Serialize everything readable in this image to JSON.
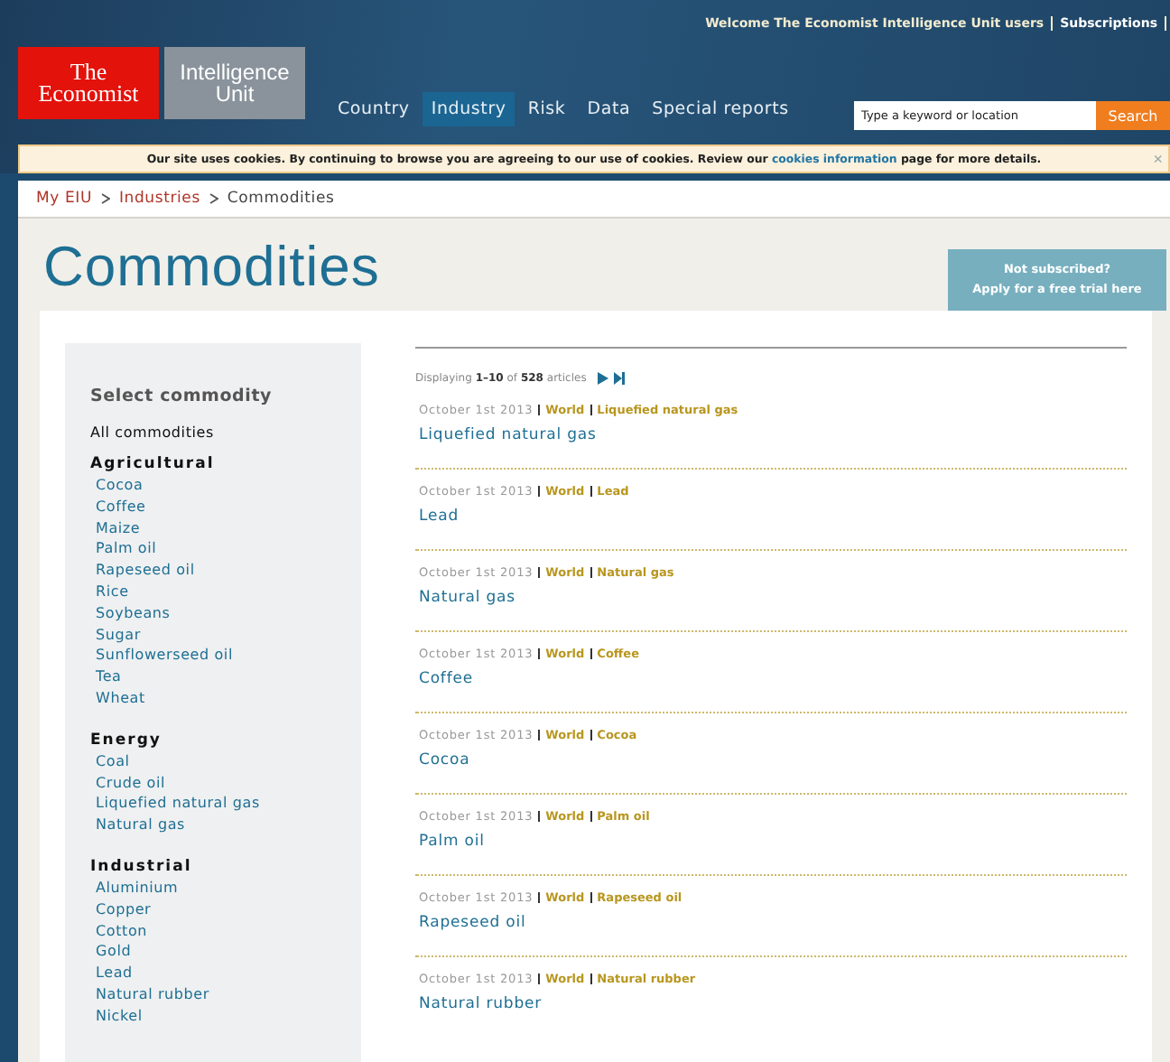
{
  "header": {
    "welcome": "Welcome The Economist Intelligence Unit users",
    "subscriptions": "Subscriptions",
    "logo_top": "The",
    "logo_bottom": "Economist",
    "unit_top": "Intelligence",
    "unit_bottom": "Unit",
    "nav": [
      {
        "label": "Country",
        "selected": false
      },
      {
        "label": "Industry",
        "selected": true
      },
      {
        "label": "Risk",
        "selected": false
      },
      {
        "label": "Data",
        "selected": false
      },
      {
        "label": "Special reports",
        "selected": false
      }
    ],
    "search": {
      "placeholder": "Type a keyword or location",
      "button": "Search"
    }
  },
  "cookie_notice": {
    "before": "Our site uses cookies. By continuing to browse you are agreeing to our use of cookies. Review our",
    "link": "cookies information",
    "after": "page for more details.",
    "close": "×"
  },
  "breadcrumb": [
    {
      "label": "My EIU",
      "current": false
    },
    {
      "label": "Industries",
      "current": false
    },
    {
      "label": "Commodities",
      "current": true
    }
  ],
  "title": "Commodities",
  "trial": {
    "line1": "Not subscribed?",
    "line2": "Apply for a free trial here"
  },
  "sidebar": {
    "heading": "Select commodity",
    "all": "All commodities",
    "groups": [
      {
        "name": "Agricultural",
        "items": [
          "Cocoa",
          "Coffee",
          "Maize",
          "Palm oil",
          "Rapeseed oil",
          "Rice",
          "Soybeans",
          "Sugar",
          "Sunflowerseed oil",
          "Tea",
          "Wheat"
        ]
      },
      {
        "name": "Energy",
        "items": [
          "Coal",
          "Crude oil",
          "Liquefied natural gas",
          "Natural gas"
        ]
      },
      {
        "name": "Industrial",
        "items": [
          "Aluminium",
          "Copper",
          "Cotton",
          "Gold",
          "Lead",
          "Natural rubber",
          "Nickel"
        ]
      }
    ]
  },
  "pager": {
    "text": "Displaying **1–10** of **528** articles"
  },
  "articles": [
    {
      "date": "October 1st 2013",
      "region": "World",
      "category": "Liquefied natural gas",
      "title": "Liquefied natural gas"
    },
    {
      "date": "October 1st 2013",
      "region": "World",
      "category": "Lead",
      "title": "Lead"
    },
    {
      "date": "October 1st 2013",
      "region": "World",
      "category": "Natural gas",
      "title": "Natural gas"
    },
    {
      "date": "October 1st 2013",
      "region": "World",
      "category": "Coffee",
      "title": "Coffee"
    },
    {
      "date": "October 1st 2013",
      "region": "World",
      "category": "Cocoa",
      "title": "Cocoa"
    },
    {
      "date": "October 1st 2013",
      "region": "World",
      "category": "Palm oil",
      "title": "Palm oil"
    },
    {
      "date": "October 1st 2013",
      "region": "World",
      "category": "Rapeseed oil",
      "title": "Rapeseed oil"
    },
    {
      "date": "October 1st 2013",
      "region": "World",
      "category": "Natural rubber",
      "title": "Natural rubber"
    }
  ]
}
